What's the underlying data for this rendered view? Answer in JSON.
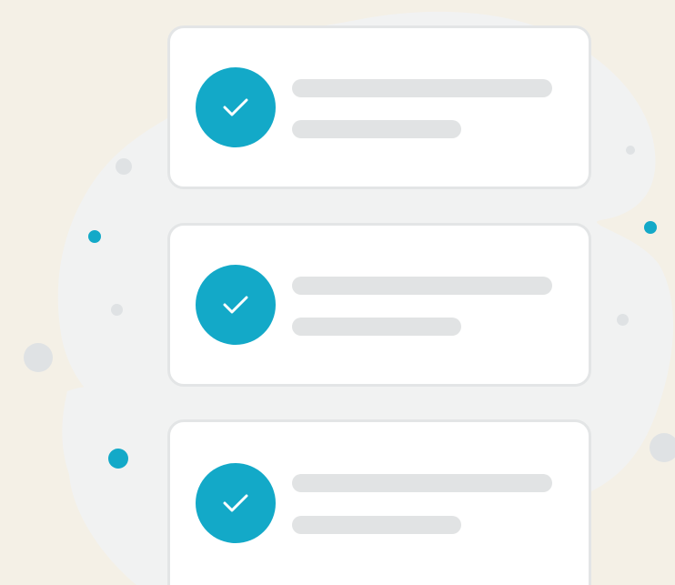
{
  "colors": {
    "background": "#f4f0e6",
    "blob": "#f1f2f2",
    "card": "#ffffff",
    "card_border": "#e3e5e6",
    "accent": "#13a9c8",
    "placeholder_line": "#e1e3e4",
    "grey_dot": "#dfe2e4"
  },
  "checklist": {
    "items": [
      {
        "icon": "check-icon",
        "checked": true
      },
      {
        "icon": "check-icon",
        "checked": true
      },
      {
        "icon": "check-icon",
        "checked": true
      }
    ]
  }
}
